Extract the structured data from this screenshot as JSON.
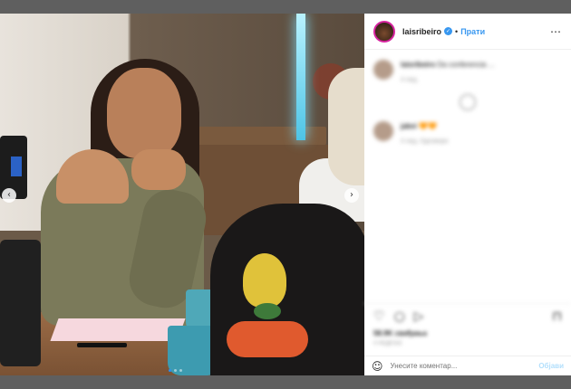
{
  "header": {
    "username": "laisribeiro",
    "follow_label": "Прати",
    "separator": "•",
    "more_icon": "⋯",
    "verified_icon": "✓"
  },
  "photo": {
    "prev_icon": "‹",
    "next_icon": "›",
    "slides": 3,
    "active_slide": 1
  },
  "comments": [
    {
      "author": "laisribeiro",
      "text": "Da conferencia ...",
      "meta": "4 нед."
    },
    {
      "author": "jakei",
      "text": "🧡🧡",
      "meta": "4 нед.  Одговори"
    }
  ],
  "actions": {
    "like_icon": "♡",
    "comment_icon": "○",
    "share_icon": "▷",
    "save_icon": "⊓",
    "likes": "58.9K свиђања",
    "date": "4 НЕДЕЉЕ"
  },
  "add_comment": {
    "emoji_icon": "☺",
    "placeholder": "Унесите коментар...",
    "post_label": "Објави"
  },
  "colors": {
    "accent": "#3897f0",
    "post_disabled": "#b2dffc",
    "overlay": "#5f5f5f"
  }
}
